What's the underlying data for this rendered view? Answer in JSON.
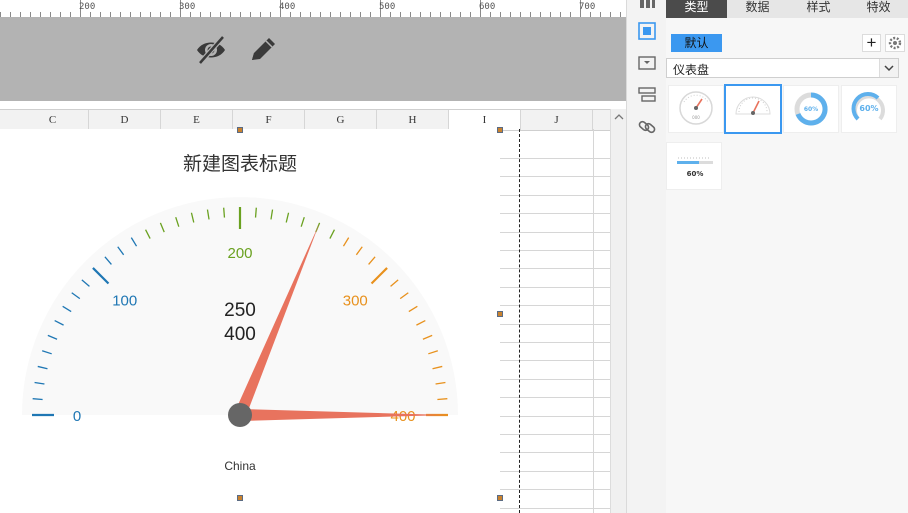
{
  "ruler": {
    "labels": [
      "200",
      "300",
      "400",
      "500",
      "600",
      "700"
    ]
  },
  "toolbar": {
    "hide_icon": "eye-slash-icon",
    "edit_icon": "pencil-icon"
  },
  "sheet": {
    "columns": [
      "C",
      "D",
      "E",
      "F",
      "G",
      "H",
      "I",
      "J"
    ],
    "selected_column": "I"
  },
  "chart": {
    "title": "新建图表标题",
    "value_line_1": "250",
    "value_line_2": "400",
    "series_label": "China"
  },
  "chart_data": {
    "type": "gauge",
    "title": "新建图表标题",
    "min": 0,
    "max": 400,
    "major_ticks": [
      0,
      100,
      200,
      300,
      400
    ],
    "tick_labels": [
      "0",
      "100",
      "200",
      "300",
      "400"
    ],
    "series": [
      {
        "name": "China",
        "values": [
          250,
          400
        ]
      }
    ],
    "colors": {
      "low": "#1f77b4",
      "mid": "#6aa120",
      "high": "#e8911d",
      "needle": "#e8735e",
      "hub": "#666666"
    }
  },
  "sidebar": {
    "icons": [
      "chart-icon",
      "box-icon",
      "insert-icon",
      "stack-icon",
      "link-icon"
    ]
  },
  "panel": {
    "tabs": [
      "类型",
      "数据",
      "样式",
      "特效"
    ],
    "active_tab": "类型",
    "default_button": "默认",
    "select_value": "仪表盘",
    "thumbnails": [
      {
        "icon": "dial-gauge-icon",
        "label": ""
      },
      {
        "icon": "half-gauge-icon",
        "label": ""
      },
      {
        "icon": "ring-gauge-icon",
        "label": "60%"
      },
      {
        "icon": "arc-gauge-icon",
        "label": "60%"
      },
      {
        "icon": "bar-gauge-icon",
        "label": "60%"
      }
    ],
    "accent": "#3b98f0"
  }
}
